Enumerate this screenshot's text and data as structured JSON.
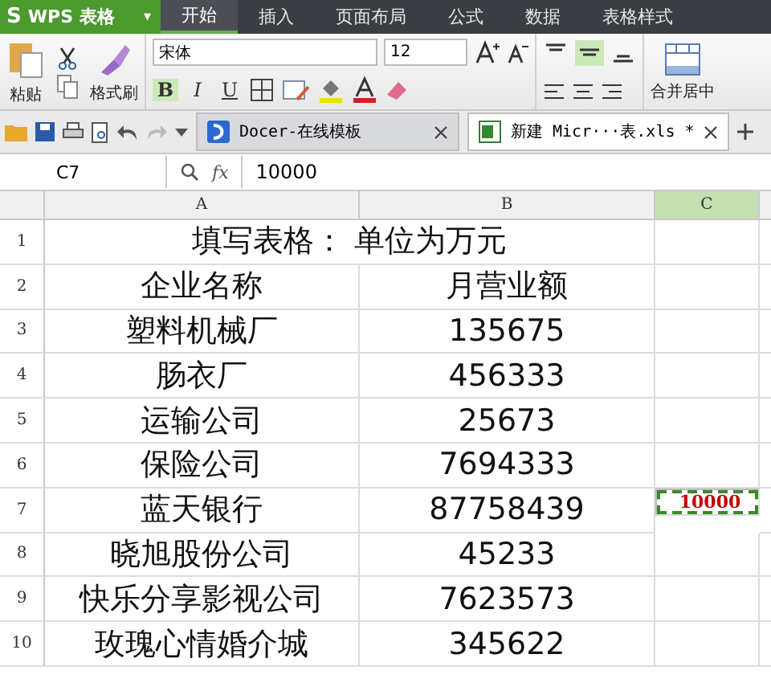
{
  "app_button": {
    "logo": "S",
    "label": "WPS 表格",
    "caret": "▾"
  },
  "ribbon_tabs": [
    {
      "label": "开始",
      "selected": true
    },
    {
      "label": "插入",
      "selected": false
    },
    {
      "label": "页面布局",
      "selected": false
    },
    {
      "label": "公式",
      "selected": false
    },
    {
      "label": "数据",
      "selected": false
    },
    {
      "label": "表格样式",
      "selected": false
    }
  ],
  "toolbar": {
    "paste": "粘贴",
    "format_painter": "格式刷",
    "font": "宋体",
    "size": "12",
    "bold": "B",
    "italic": "I",
    "underline": "U",
    "merge": "合并居中"
  },
  "doc_tabs": [
    {
      "label": "Docer-在线模板",
      "selected": false,
      "kind": "docer"
    },
    {
      "label": "新建 Micr···表.xls *",
      "selected": true,
      "kind": "sheet"
    }
  ],
  "formula_bar": {
    "cell": "C7",
    "fx": "fx",
    "value": "10000"
  },
  "columns": [
    {
      "label": "A",
      "selected": false
    },
    {
      "label": "B",
      "selected": false
    },
    {
      "label": "C",
      "selected": true
    }
  ],
  "rows": [
    {
      "number": "1",
      "cells": [
        "填写表格：  单位为万元"
      ]
    },
    {
      "number": "2",
      "cells": [
        "企业名称",
        "月营业额"
      ]
    },
    {
      "number": "3",
      "cells": [
        "塑料机械厂",
        "135675"
      ]
    },
    {
      "number": "4",
      "cells": [
        "肠衣厂",
        "456333"
      ]
    },
    {
      "number": "5",
      "cells": [
        "运输公司",
        "25673"
      ]
    },
    {
      "number": "6",
      "cells": [
        "保险公司",
        "7694333"
      ]
    },
    {
      "number": "7",
      "cells": [
        "蓝天银行",
        "87758439",
        "10000"
      ],
      "selected": true
    },
    {
      "number": "8",
      "cells": [
        "晓旭股份公司",
        "45233"
      ]
    },
    {
      "number": "9",
      "cells": [
        "快乐分享影视公司",
        "7623573"
      ]
    },
    {
      "number": "10",
      "cells": [
        "玫瑰心情婚介城",
        "345622"
      ]
    }
  ]
}
